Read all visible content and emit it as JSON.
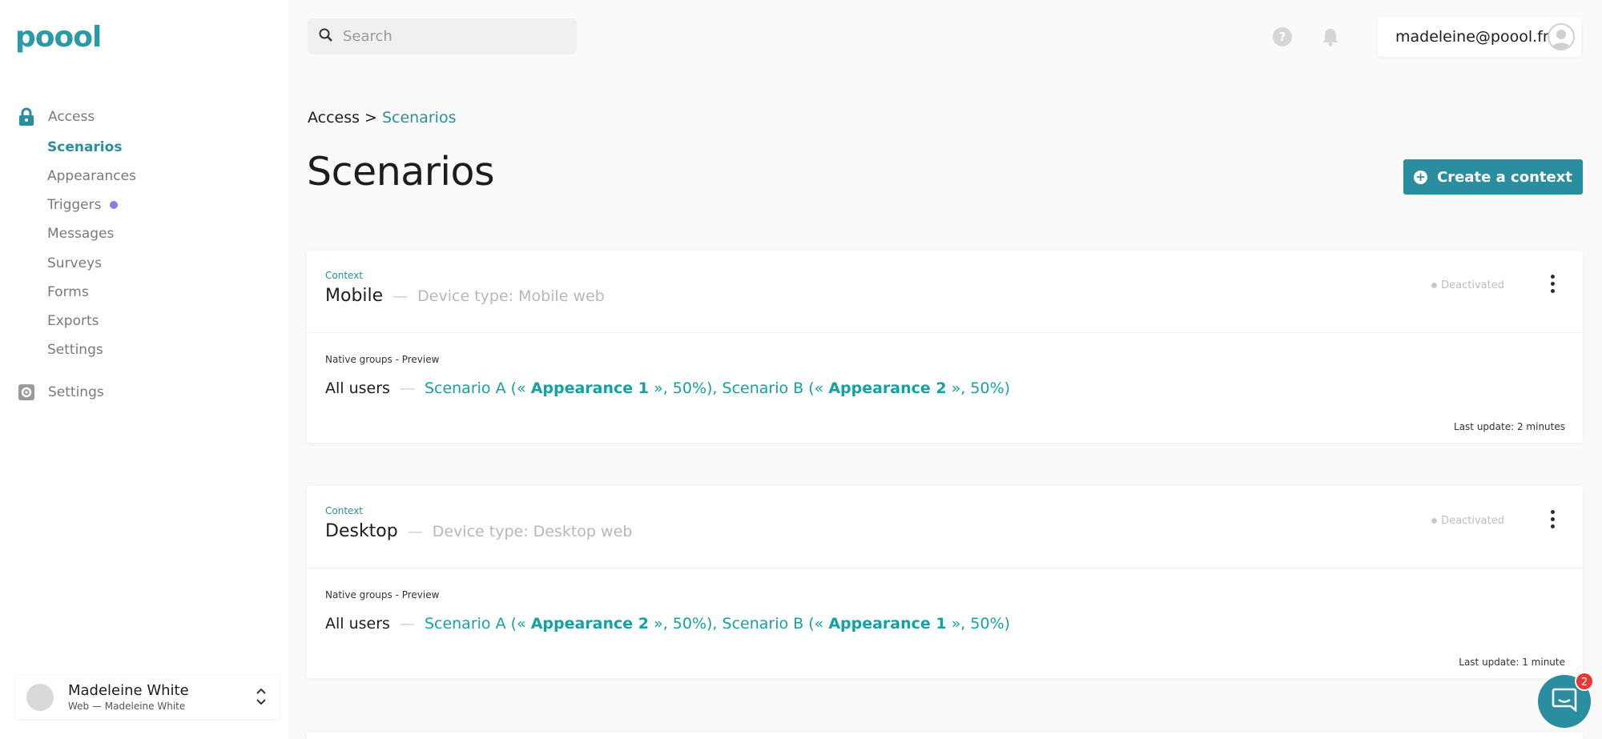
{
  "brand": {
    "logo_text": "poool",
    "accent": "#2a8ea0"
  },
  "sidebar": {
    "sections": [
      {
        "label": "Access",
        "icon": "lock-icon"
      },
      {
        "label": "Settings",
        "icon": "gear-icon"
      }
    ],
    "items": [
      {
        "label": "Scenarios",
        "active": true
      },
      {
        "label": "Appearances"
      },
      {
        "label": "Triggers",
        "badge_dot": true
      },
      {
        "label": "Messages"
      },
      {
        "label": "Surveys"
      },
      {
        "label": "Forms"
      },
      {
        "label": "Exports"
      },
      {
        "label": "Settings"
      }
    ],
    "account": {
      "name": "Madeleine White",
      "sub": "Web — Madeleine White"
    }
  },
  "topbar": {
    "search_placeholder": "Search",
    "user_email": "madeleine@poool.fr"
  },
  "breadcrumb": {
    "root": "Access",
    "separator": ">",
    "current": "Scenarios"
  },
  "page": {
    "title": "Scenarios",
    "create_button": "Create a context"
  },
  "contexts": [
    {
      "label": "Context",
      "name": "Mobile",
      "dash": "—",
      "device": "Device type: Mobile web",
      "status": "Deactivated",
      "groups_label": "Native groups - Preview",
      "audience": "All users",
      "scenario_a_prefix": "Scenario A («",
      "scenario_a_appearance": "Appearance 1",
      "scenario_a_suffix": "», 50%), Scenario B («",
      "scenario_b_appearance": "Appearance 2",
      "scenario_b_suffix": "», 50%)",
      "last_update": "Last update: 2 minutes"
    },
    {
      "label": "Context",
      "name": "Desktop",
      "dash": "—",
      "device": "Device type: Desktop web",
      "status": "Deactivated",
      "groups_label": "Native groups - Preview",
      "audience": "All users",
      "scenario_a_prefix": "Scenario A («",
      "scenario_a_appearance": "Appearance 2",
      "scenario_a_suffix": "», 50%), Scenario B («",
      "scenario_b_appearance": "Appearance 1",
      "scenario_b_suffix": "», 50%)",
      "last_update": "Last update: 1 minute"
    }
  ],
  "chat": {
    "badge_count": "2",
    "icon": "chat-icon"
  }
}
